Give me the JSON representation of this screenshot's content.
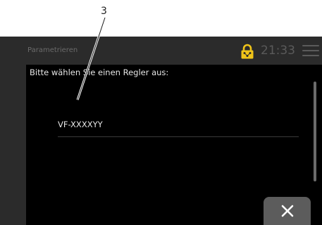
{
  "callout": {
    "number": "3"
  },
  "header": {
    "title": "Parametrieren",
    "time": "21:33",
    "lock_icon": "lock-icon",
    "menu_icon": "hamburger-menu-icon",
    "accent_color": "#f0c419"
  },
  "screen": {
    "prompt": "Bitte wählen Sie einen Regler aus:",
    "controllers": [
      {
        "label": "VF-XXXXYY"
      }
    ]
  },
  "footer": {
    "close_icon": "close-icon"
  }
}
